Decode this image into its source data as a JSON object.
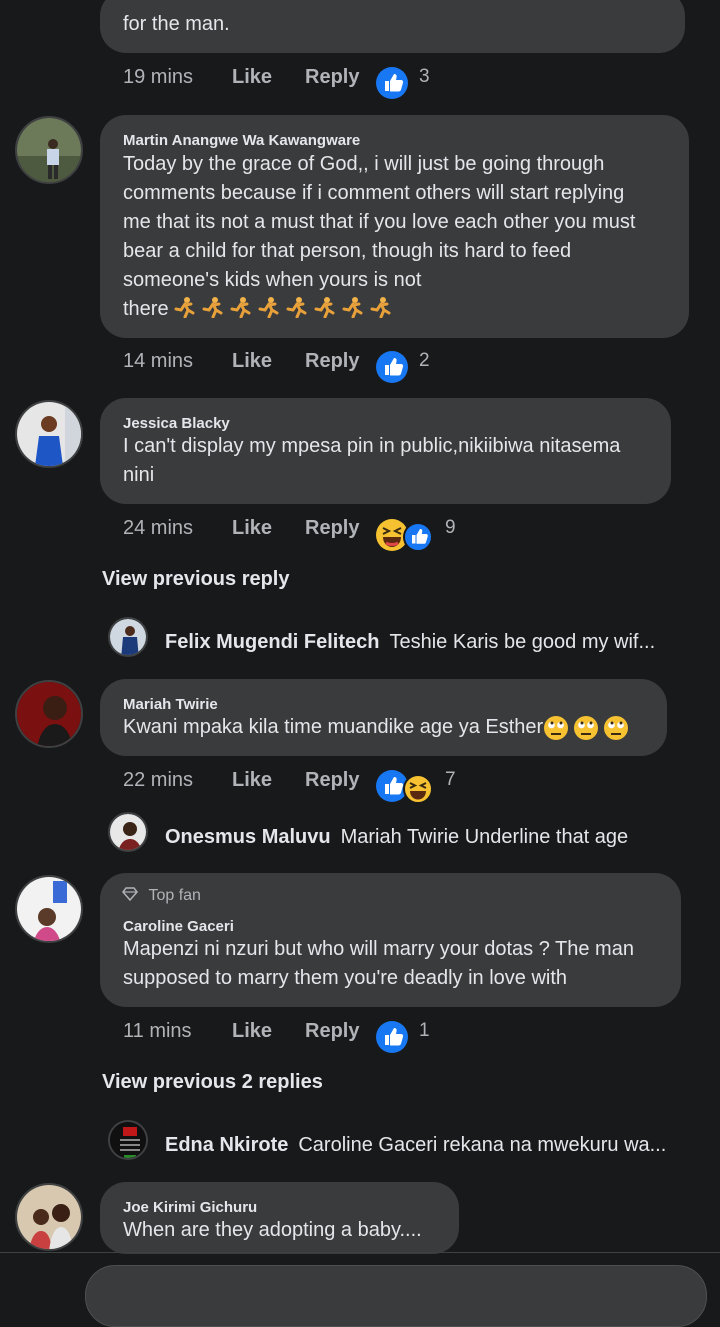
{
  "comments": [
    {
      "text_tail": "for the man.",
      "time": "19 mins",
      "like": "Like",
      "reply": "Reply",
      "count": "3",
      "reactions": [
        "like-icon"
      ]
    },
    {
      "name": "Martin Anangwe Wa Kawangware",
      "lines": [
        "Today by the grace of God,, i will just be going through",
        "comments because if i comment others will start replying",
        "me that its not a must that if you love each other you must",
        "bear a child for that person, though its hard to feed",
        "someone's kids when yours is not",
        "there"
      ],
      "time": "14 mins",
      "like": "Like",
      "reply": "Reply",
      "count": "2",
      "reactions": [
        "like-icon"
      ]
    },
    {
      "name": "Jessica Blacky",
      "lines": [
        "I can't display my mpesa pin in public,nikiibiwa nitasema",
        "nini"
      ],
      "time": "24 mins",
      "like": "Like",
      "reply": "Reply",
      "count": "9",
      "reactions": [
        "haha-icon",
        "like-icon"
      ],
      "view_previous": "View previous reply",
      "reply_preview": {
        "name": "Felix Mugendi Felitech",
        "text": "Teshie Karis be good my wif..."
      }
    },
    {
      "name": "Mariah Twirie",
      "lines": [
        "Kwani mpaka kila time muandike age ya Esther"
      ],
      "time": "22 mins",
      "like": "Like",
      "reply": "Reply",
      "count": "7",
      "reactions": [
        "like-icon",
        "haha-icon"
      ],
      "reply_preview": {
        "name": "Onesmus Maluvu",
        "text": "Mariah Twirie Underline that age"
      }
    },
    {
      "badge": "Top fan",
      "name": "Caroline Gaceri",
      "lines": [
        "Mapenzi ni nzuri but who will marry your dotas ? The man",
        "supposed to marry them you're deadly in love with"
      ],
      "time": "11 mins",
      "like": "Like",
      "reply": "Reply",
      "count": "1",
      "reactions": [
        "like-icon"
      ],
      "view_previous": "View previous 2 replies",
      "reply_preview": {
        "name": "Edna Nkirote",
        "text": "Caroline Gaceri rekana na mwekuru wa..."
      }
    },
    {
      "name": "Joe Kirimi Gichuru",
      "lines": [
        "When are they adopting a baby...."
      ]
    }
  ],
  "colors": {
    "background": "#18191a",
    "bubble": "#3a3b3c",
    "like_blue": "#1877f2",
    "haha_yellow": "#f7c232"
  }
}
